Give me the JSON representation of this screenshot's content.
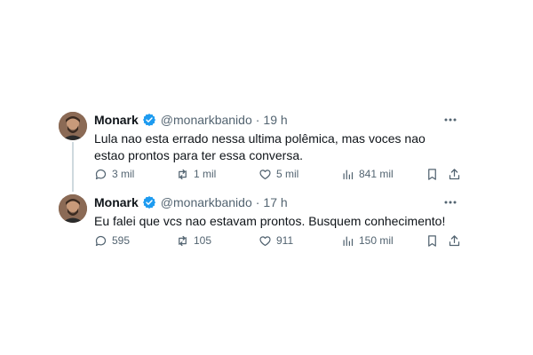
{
  "colors": {
    "verified": "#1d9bf0",
    "secondary_text": "#536471",
    "thread_line": "#cfd9de"
  },
  "tweets": [
    {
      "name": "Monark",
      "handle": "@monarkbanido",
      "separator": "·",
      "time": "19 h",
      "text": "Lula nao esta errado nessa ultima polêmica, mas voces nao estao prontos para ter essa conversa.",
      "replies": "3 mil",
      "retweets": "1 mil",
      "likes": "5 mil",
      "views": "841 mil"
    },
    {
      "name": "Monark",
      "handle": "@monarkbanido",
      "separator": "·",
      "time": "17 h",
      "text": "Eu falei que vcs nao estavam prontos. Busquem conhecimento!",
      "replies": "595",
      "retweets": "105",
      "likes": "911",
      "views": "150 mil"
    }
  ]
}
